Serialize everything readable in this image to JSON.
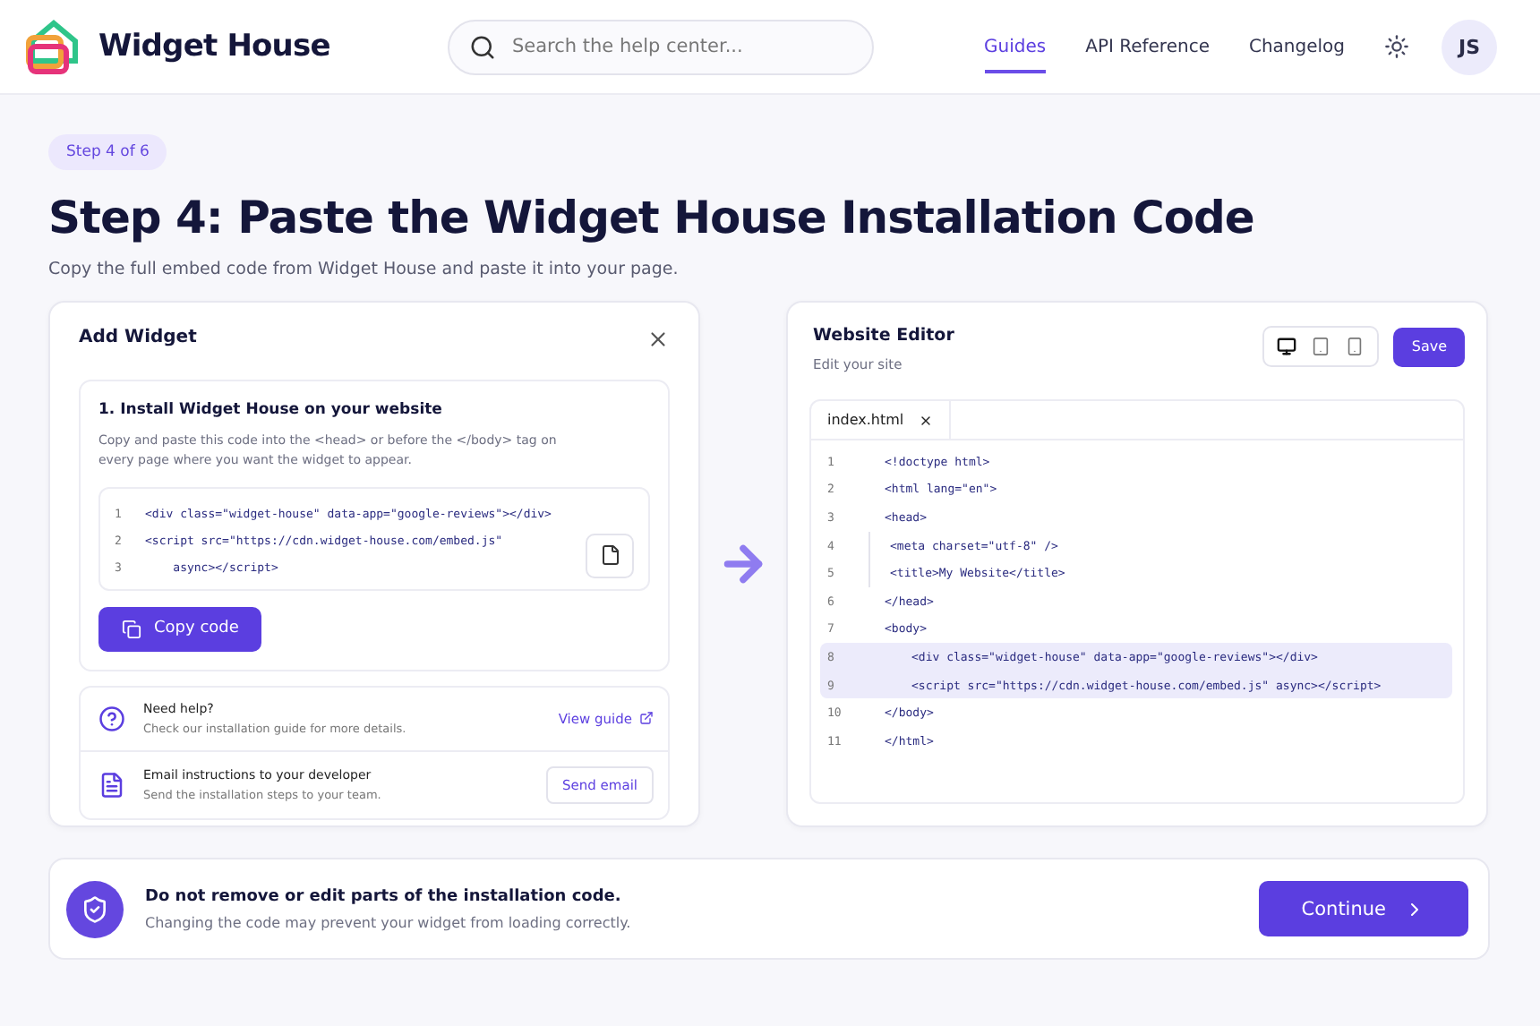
{
  "brand": {
    "name": "Widget House"
  },
  "search": {
    "placeholder": "Search the help center..."
  },
  "nav": [
    {
      "label": "Guides",
      "selected": true
    },
    {
      "label": "API Reference",
      "selected": false
    },
    {
      "label": "Changelog",
      "selected": false
    }
  ],
  "avatar": {
    "initials": "JS"
  },
  "step_badge": "Step 4 of 6",
  "title": "Step 4: Paste the Widget House Installation Code",
  "subtitle": "Copy the full embed code from Widget House and paste it into your page.",
  "add_widget": {
    "title": "Add Widget",
    "install": {
      "heading": "1. Install Widget House on your website",
      "description": "Copy and paste this code into the <head> or before the </body> tag on every page where you want the widget to appear.",
      "code": [
        {
          "number": "1",
          "text": "<div class=\"widget-house\" data-app=\"google-reviews\"></div>"
        },
        {
          "number": "2",
          "text": "<script src=\"https://cdn.widget-house.com/embed.js\""
        },
        {
          "number": "3",
          "text": "    async></script>"
        }
      ],
      "copy_button": "Copy code"
    },
    "help_rows": [
      {
        "kind": "help",
        "title": "Need help?",
        "description": "Check our installation guide for more details.",
        "action": "View guide"
      },
      {
        "kind": "email",
        "title": "Email instructions to your developer",
        "description": "Send the installation steps to your team.",
        "action": "Send email"
      }
    ]
  },
  "editor": {
    "title": "Website Editor",
    "subtitle": "Edit your site",
    "devices": [
      {
        "kind": "desktop",
        "selected": true
      },
      {
        "kind": "tablet",
        "selected": false
      },
      {
        "kind": "phone",
        "selected": false
      }
    ],
    "save_button": "Save",
    "tab": "index.html",
    "lines": [
      {
        "number": "1",
        "text": "<!doctype html>",
        "indented": false,
        "highlighted": false
      },
      {
        "number": "2",
        "text": "<html lang=\"en\">",
        "indented": false,
        "highlighted": false
      },
      {
        "number": "3",
        "text": "<head>",
        "indented": false,
        "highlighted": false
      },
      {
        "number": "4",
        "text": "<meta charset=\"utf-8\" />",
        "indented": true,
        "highlighted": false
      },
      {
        "number": "5",
        "text": "<title>My Website</title>",
        "indented": true,
        "highlighted": false
      },
      {
        "number": "6",
        "text": "</head>",
        "indented": false,
        "highlighted": false
      },
      {
        "number": "7",
        "text": "<body>",
        "indented": false,
        "highlighted": false
      },
      {
        "number": "8",
        "text": "<div class=\"widget-house\" data-app=\"google-reviews\"></div>",
        "indented": true,
        "highlighted": true
      },
      {
        "number": "9",
        "text": "<script src=\"https://cdn.widget-house.com/embed.js\" async></script>",
        "indented": true,
        "highlighted": true
      },
      {
        "number": "10",
        "text": "</body>",
        "indented": false,
        "highlighted": false
      },
      {
        "number": "11",
        "text": "</html>",
        "indented": false,
        "highlighted": false
      }
    ]
  },
  "warning": {
    "title": "Do not remove or edit parts of the installation code.",
    "description": "Changing the code may prevent your widget from loading correctly.",
    "button": "Continue"
  }
}
